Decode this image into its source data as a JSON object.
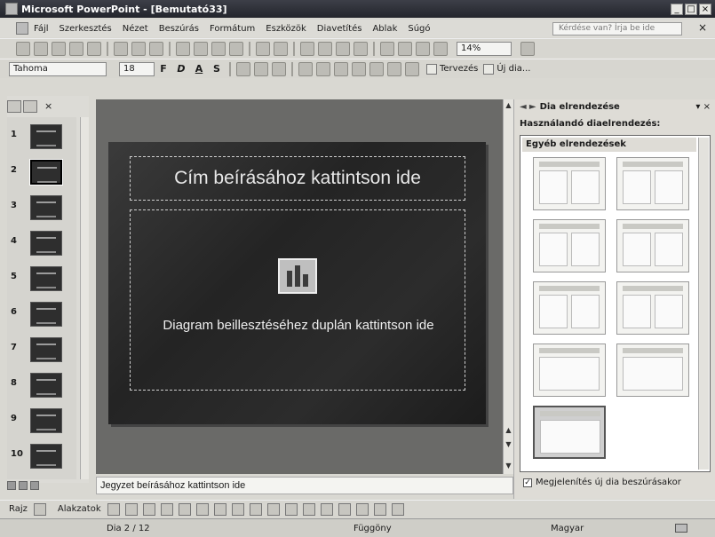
{
  "window": {
    "title": "Microsoft PowerPoint - [Bemutató33]",
    "controls": [
      "_",
      "□",
      "×"
    ]
  },
  "menubar": {
    "items": [
      "Fájl",
      "Szerkesztés",
      "Nézet",
      "Beszúrás",
      "Formátum",
      "Eszközök",
      "Diavetítés",
      "Ablak",
      "Súgó"
    ],
    "help_placeholder": "Kérdése van? Írja be ide",
    "close": "×"
  },
  "toolbar": {
    "zoom": "14%"
  },
  "formatting": {
    "font": "Tahoma",
    "size": "18",
    "buttons": [
      "F",
      "D",
      "A",
      "S"
    ],
    "design_label": "Tervezés",
    "new_slide_label": "Új dia..."
  },
  "slides": {
    "count_visible": [
      "1",
      "2",
      "3",
      "4",
      "5",
      "6",
      "7",
      "8",
      "9",
      "10"
    ],
    "selected": 2
  },
  "slide": {
    "title_placeholder": "Cím beírásához kattintson ide",
    "chart_placeholder": "Diagram beillesztéséhez duplán kattintson ide"
  },
  "notes": {
    "placeholder": "Jegyzet beírásához kattintson ide"
  },
  "taskpane": {
    "title": "Dia elrendezése",
    "subtitle": "Használandó diaelrendezés:",
    "group": "Egyéb elrendezések",
    "checkbox_label": "Megjelenítés új dia beszúrásakor",
    "checkbox_checked": true
  },
  "drawing": {
    "draw_label": "Rajz",
    "autoshapes_label": "Alakzatok"
  },
  "status": {
    "slide": "Dia 2 / 12",
    "design": "Függöny",
    "language": "Magyar"
  }
}
